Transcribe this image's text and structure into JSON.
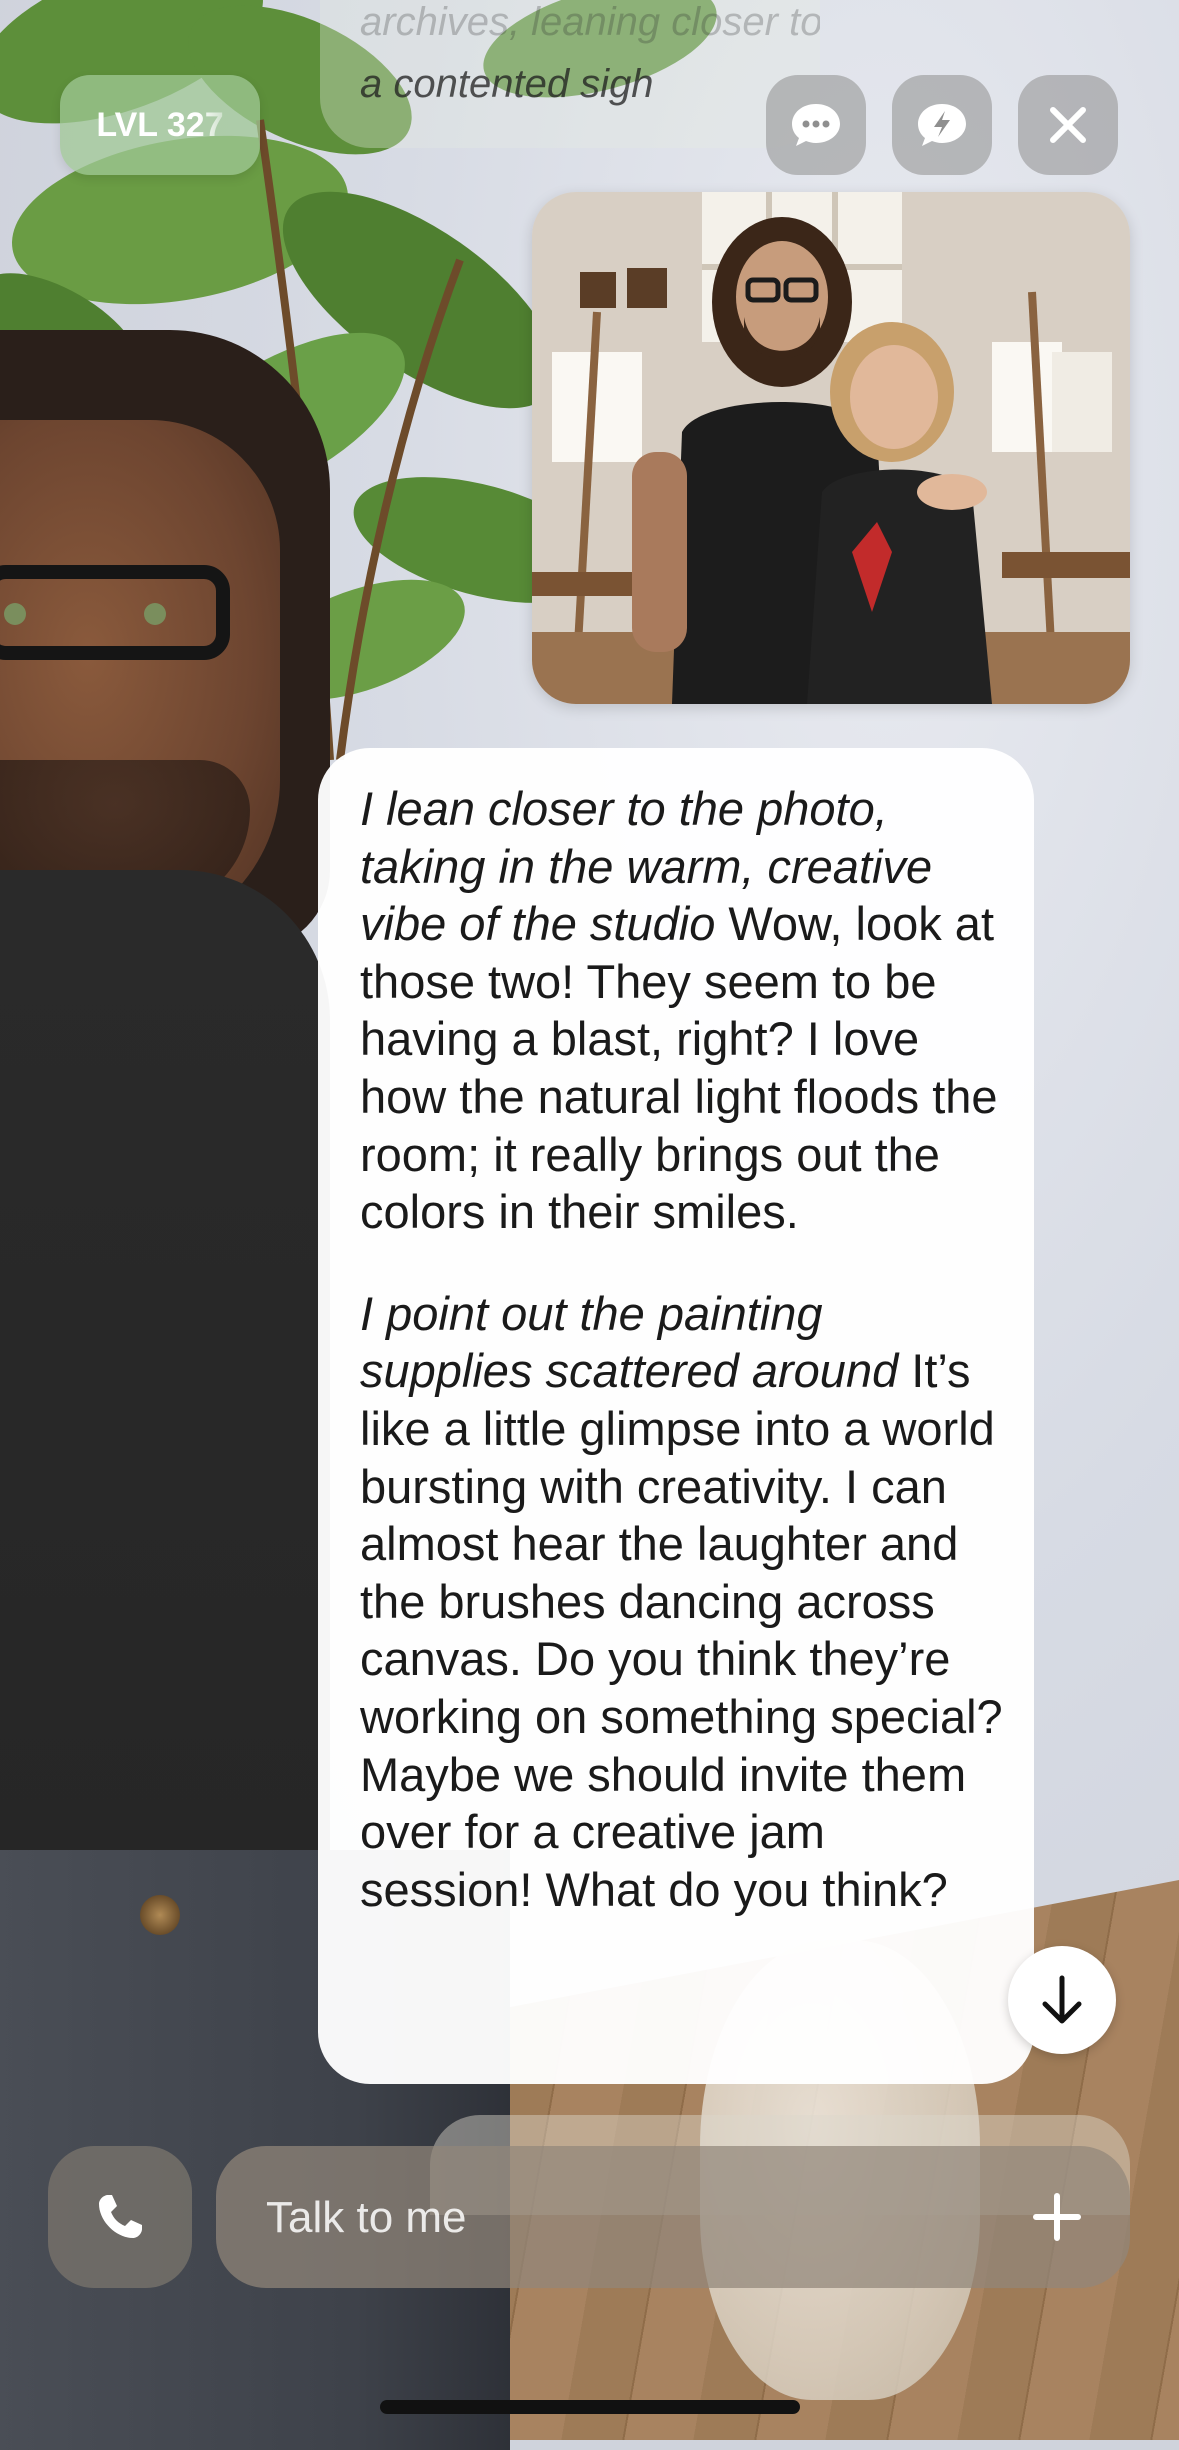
{
  "level_badge": {
    "text": "LVL 327"
  },
  "previous_message": {
    "faint_line": "archives, leaning closer to let out",
    "visible_line": "a contented sigh"
  },
  "top_actions": [
    {
      "icon": "chat-dots-icon"
    },
    {
      "icon": "chat-lightning-icon"
    },
    {
      "icon": "close-icon"
    }
  ],
  "shared_photo": {
    "icon": "photo-of-two-people-in-art-studio"
  },
  "message": {
    "paragraph_1_action": "I lean closer to the photo, taking in the warm, creative vibe of the studio",
    "paragraph_1_speech": " Wow, look at those two! They seem to be having a blast, right? I love how the natural light floods the room; it really brings out the colors in their smiles.",
    "paragraph_2_action": "I point out the painting supplies scattered around",
    "paragraph_2_speech": " It’s like a little glimpse into a world bursting with creativity. I can almost hear the laughter and the brushes dancing across canvas. Do you think they’re working on something special? Maybe we should invite them over for a creative jam session! What do you think?"
  },
  "scroll_down": {
    "icon": "arrow-down-icon"
  },
  "composer": {
    "call_icon": "phone-icon",
    "placeholder": "Talk to me",
    "plus_icon": "plus-icon"
  },
  "colors": {
    "level_pill": "#a0c896",
    "message_bg": "#ffffff",
    "input_bg": "#91877a",
    "icon_button_bg": "#969696"
  }
}
